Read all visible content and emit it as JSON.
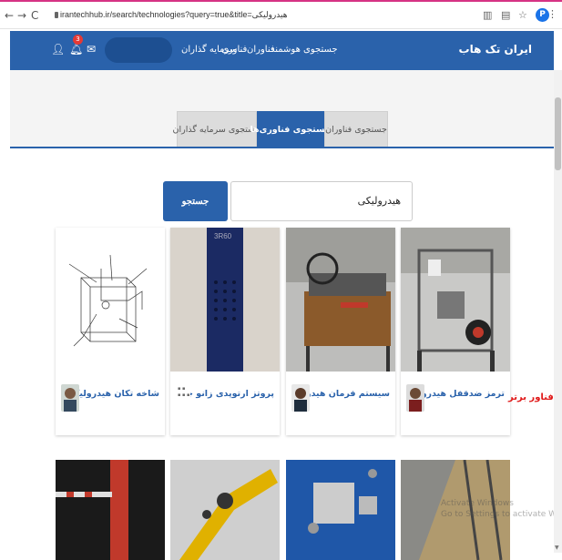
{
  "browser": {
    "url": "irantechhub.ir/search/technologies?query=true&title=هیدرولیکی",
    "profile_initial": "P"
  },
  "header": {
    "brand": "ایران تک هاب",
    "menu": [
      "جستجوی هوشمند",
      "فناوران",
      "فناوری",
      "سرمایه گذاران"
    ],
    "notification_count": "3"
  },
  "tabs": [
    "جستجوی سرمایه گذاران",
    "جستجوی فناوری‌ها",
    "جستجوی فناوران"
  ],
  "search": {
    "query": "هیدرولیکی",
    "button": "جستجو"
  },
  "cards": [
    {
      "title": "شاخه تکان هیدرولیکی"
    },
    {
      "title": "پروتز ارتوپدی زانو چند ..."
    },
    {
      "title": "سیستم فرمان هیدرولی..."
    },
    {
      "title": "ترمز ضدقفل هیدرولیک..."
    }
  ],
  "promo": "فناور برتر",
  "card2_labels": {
    "third": "3R60"
  },
  "watermark": {
    "line1": "Activate Windows",
    "line2": "Go to Settings to activate Windows."
  }
}
